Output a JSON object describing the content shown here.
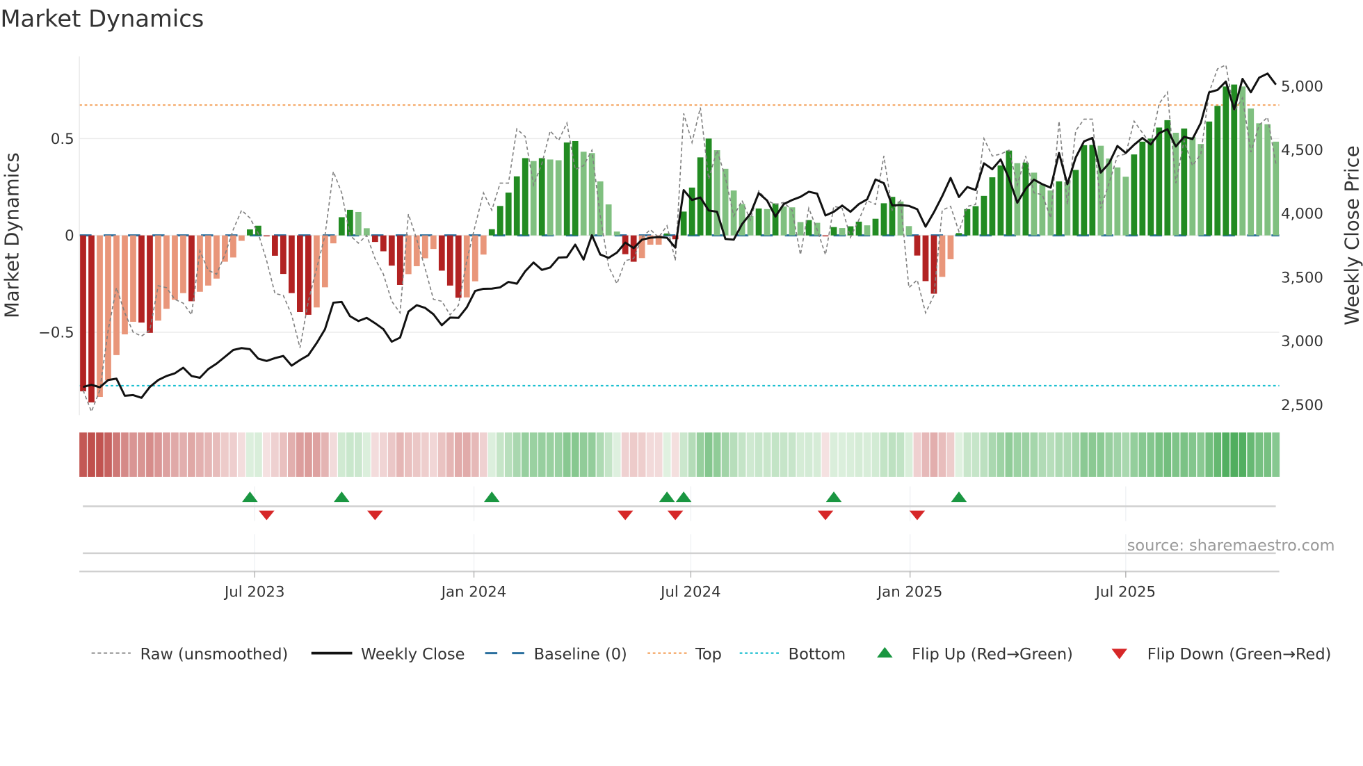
{
  "title": "Market Dynamics",
  "source": "source: sharemaestro.com",
  "chart_data": {
    "type": "bar",
    "title": "Market Dynamics",
    "ylabel_left": "Market Dynamics",
    "ylabel_right": "Weekly Close Price",
    "x_start": "2023-02-07",
    "x_step_days": 7,
    "x_ticks": [
      {
        "date": "2023-07-01",
        "label": "Jul 2023"
      },
      {
        "date": "2024-01-01",
        "label": "Jan 2024"
      },
      {
        "date": "2024-07-01",
        "label": "Jul 2024"
      },
      {
        "date": "2025-01-01",
        "label": "Jan 2025"
      },
      {
        "date": "2025-07-01",
        "label": "Jul 2025"
      }
    ],
    "ylim_left": [
      -0.928,
      0.924
    ],
    "ylim_right": [
      2419,
      5232
    ],
    "left_ticks": [
      {
        "value": 0.5,
        "label": "0.5"
      },
      {
        "value": 0,
        "label": "0"
      },
      {
        "value": -0.5,
        "label": "−0.5"
      }
    ],
    "right_ticks": [
      {
        "value": 5000,
        "label": "5,000"
      },
      {
        "value": 4500,
        "label": "4,500"
      },
      {
        "value": 4000,
        "label": "4,000"
      },
      {
        "value": 3500,
        "label": "3,500"
      },
      {
        "value": 3000,
        "label": "3,000"
      },
      {
        "value": 2500,
        "label": "2,500"
      }
    ],
    "baseline": 0,
    "top_level": 0.673,
    "bottom_level": -0.776,
    "grid": true,
    "legend_position": "bottom",
    "colors": {
      "pos_strong": "#228b22",
      "pos_weak": "#80c080",
      "neg_strong": "#b22222",
      "neg_weak": "#e9967a",
      "raw": "#808080",
      "close": "#111111",
      "baseline": "#2a6f9e",
      "top": "#f4a460",
      "bottom": "#17becf",
      "flip_up": "#1a9641",
      "flip_down": "#d62728"
    },
    "dynamics": [
      -0.805,
      -0.862,
      -0.834,
      -0.749,
      -0.618,
      -0.511,
      -0.446,
      -0.45,
      -0.503,
      -0.44,
      -0.379,
      -0.332,
      -0.298,
      -0.34,
      -0.291,
      -0.259,
      -0.223,
      -0.136,
      -0.114,
      -0.028,
      0.031,
      0.05,
      -0.005,
      -0.105,
      -0.199,
      -0.298,
      -0.396,
      -0.41,
      -0.372,
      -0.268,
      -0.041,
      0.094,
      0.132,
      0.121,
      0.037,
      -0.034,
      -0.082,
      -0.156,
      -0.256,
      -0.2,
      -0.159,
      -0.118,
      -0.07,
      -0.182,
      -0.259,
      -0.322,
      -0.32,
      -0.237,
      -0.099,
      0.032,
      0.152,
      0.221,
      0.305,
      0.399,
      0.384,
      0.399,
      0.392,
      0.388,
      0.48,
      0.487,
      0.432,
      0.425,
      0.279,
      0.16,
      0.02,
      -0.097,
      -0.136,
      -0.117,
      -0.048,
      -0.048,
      0.01,
      -0.02,
      0.123,
      0.247,
      0.403,
      0.5,
      0.44,
      0.344,
      0.232,
      0.162,
      0.1,
      0.139,
      0.136,
      0.165,
      0.149,
      0.145,
      0.069,
      0.079,
      0.065,
      -0.005,
      0.043,
      0.038,
      0.047,
      0.071,
      0.052,
      0.086,
      0.166,
      0.199,
      0.175,
      0.048,
      -0.104,
      -0.236,
      -0.301,
      -0.214,
      -0.123,
      0.012,
      0.136,
      0.151,
      0.204,
      0.3,
      0.361,
      0.438,
      0.373,
      0.376,
      0.324,
      0.263,
      0.232,
      0.279,
      0.275,
      0.338,
      0.466,
      0.467,
      0.463,
      0.397,
      0.351,
      0.303,
      0.418,
      0.484,
      0.5,
      0.557,
      0.595,
      0.53,
      0.552,
      0.508,
      0.472,
      0.588,
      0.669,
      0.769,
      0.779,
      0.769,
      0.655,
      0.579,
      0.574,
      0.484
    ],
    "raw": [
      -0.8,
      -0.91,
      -0.8,
      -0.49,
      -0.27,
      -0.4,
      -0.5,
      -0.52,
      -0.49,
      -0.26,
      -0.27,
      -0.33,
      -0.35,
      -0.41,
      -0.08,
      -0.18,
      -0.2,
      -0.1,
      0.03,
      0.13,
      0.09,
      0.01,
      -0.13,
      -0.3,
      -0.31,
      -0.41,
      -0.58,
      -0.34,
      -0.17,
      0.0,
      0.33,
      0.22,
      0.0,
      -0.04,
      0.0,
      -0.12,
      -0.2,
      -0.34,
      -0.4,
      0.11,
      -0.02,
      -0.17,
      -0.33,
      -0.34,
      -0.41,
      -0.36,
      -0.13,
      0.05,
      0.22,
      0.13,
      0.27,
      0.27,
      0.55,
      0.51,
      0.26,
      0.37,
      0.54,
      0.49,
      0.58,
      0.34,
      0.36,
      0.44,
      0.1,
      -0.16,
      -0.25,
      -0.13,
      -0.12,
      -0.01,
      0.03,
      -0.01,
      0.05,
      -0.13,
      0.63,
      0.48,
      0.66,
      0.29,
      0.44,
      0.3,
      0.1,
      0.18,
      0.08,
      0.23,
      0.18,
      0.16,
      0.17,
      0.13,
      -0.1,
      0.14,
      0.03,
      -0.1,
      0.15,
      0.14,
      -0.01,
      0.08,
      0.18,
      0.16,
      0.41,
      0.13,
      0.18,
      -0.27,
      -0.23,
      -0.4,
      -0.31,
      0.13,
      0.15,
      0.02,
      0.15,
      0.16,
      0.5,
      0.41,
      0.42,
      0.44,
      0.26,
      0.41,
      0.22,
      0.21,
      0.09,
      0.59,
      0.16,
      0.54,
      0.6,
      0.6,
      0.14,
      0.27,
      0.41,
      0.42,
      0.59,
      0.53,
      0.47,
      0.68,
      0.74,
      0.27,
      0.49,
      0.36,
      0.42,
      0.74,
      0.86,
      0.88,
      0.64,
      0.71,
      0.43,
      0.57,
      0.61,
      0.37
    ],
    "close": [
      2640,
      2657,
      2637,
      2694,
      2705,
      2571,
      2576,
      2555,
      2640,
      2694,
      2726,
      2747,
      2791,
      2726,
      2712,
      2780,
      2823,
      2876,
      2930,
      2945,
      2936,
      2862,
      2844,
      2866,
      2883,
      2807,
      2851,
      2889,
      2984,
      3093,
      3301,
      3307,
      3195,
      3157,
      3182,
      3140,
      3093,
      2995,
      3027,
      3231,
      3281,
      3260,
      3210,
      3124,
      3184,
      3182,
      3264,
      3393,
      3410,
      3411,
      3421,
      3464,
      3450,
      3547,
      3616,
      3558,
      3577,
      3654,
      3658,
      3756,
      3639,
      3830,
      3679,
      3652,
      3694,
      3772,
      3729,
      3795,
      3810,
      3816,
      3810,
      3733,
      4184,
      4106,
      4126,
      4024,
      4014,
      3801,
      3795,
      3917,
      3999,
      4160,
      4102,
      3976,
      4074,
      4106,
      4131,
      4171,
      4156,
      3985,
      4014,
      4063,
      4014,
      4074,
      4112,
      4267,
      4238,
      4063,
      4067,
      4060,
      4034,
      3897,
      4010,
      4137,
      4279,
      4130,
      4208,
      4185,
      4394,
      4348,
      4424,
      4276,
      4085,
      4194,
      4266,
      4230,
      4203,
      4475,
      4230,
      4439,
      4566,
      4593,
      4321,
      4394,
      4530,
      4475,
      4539,
      4593,
      4542,
      4630,
      4661,
      4526,
      4602,
      4584,
      4711,
      4951,
      4969,
      5035,
      4817,
      5056,
      4951,
      5066,
      5098,
      5011
    ],
    "legend": [
      {
        "key": "raw",
        "label": "Raw (unsmoothed)"
      },
      {
        "key": "close",
        "label": "Weekly Close"
      },
      {
        "key": "baseline",
        "label": "Baseline (0)"
      },
      {
        "key": "top",
        "label": "Top"
      },
      {
        "key": "bottom",
        "label": "Bottom"
      },
      {
        "key": "flip_up",
        "label": "Flip Up (Red→Green)"
      },
      {
        "key": "flip_down",
        "label": "Flip Down (Green→Red)"
      }
    ]
  }
}
